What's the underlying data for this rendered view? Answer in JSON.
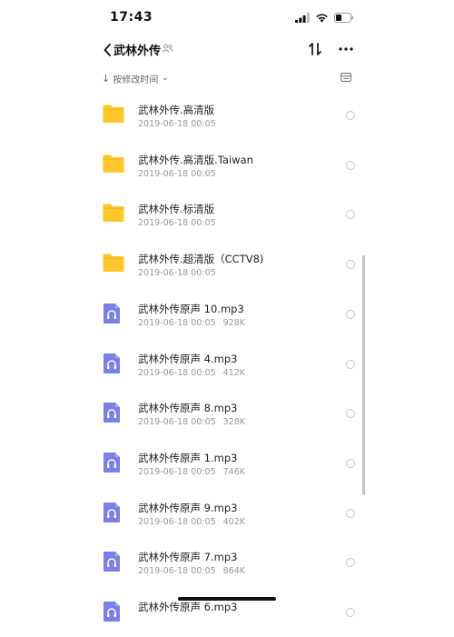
{
  "status": {
    "time": "17:43"
  },
  "header": {
    "title": "武林外传"
  },
  "sort": {
    "label": "按修改时间"
  },
  "colors": {
    "folder": "#FFC72C",
    "audio": "#7B7FE6"
  },
  "files": [
    {
      "name": "武林外传.高清版",
      "date": "2019-06-18 00:05",
      "size": "",
      "type": "folder-icon"
    },
    {
      "name": "武林外传.高清版.Taiwan",
      "date": "2019-06-18 00:05",
      "size": "",
      "type": "folder-icon"
    },
    {
      "name": "武林外传.标清版",
      "date": "2019-06-18 00:05",
      "size": "",
      "type": "folder-icon"
    },
    {
      "name": "武林外传.超清版（CCTV8)",
      "date": "2019-06-18 00:05",
      "size": "",
      "type": "folder-icon"
    },
    {
      "name": "武林外传原声 10.mp3",
      "date": "2019-06-18 00:05",
      "size": "928K",
      "type": "audio-file-icon"
    },
    {
      "name": "武林外传原声 4.mp3",
      "date": "2019-06-18 00:05",
      "size": "412K",
      "type": "audio-file-icon"
    },
    {
      "name": "武林外传原声 8.mp3",
      "date": "2019-06-18 00:05",
      "size": "328K",
      "type": "audio-file-icon"
    },
    {
      "name": "武林外传原声 1.mp3",
      "date": "2019-06-18 00:05",
      "size": "746K",
      "type": "audio-file-icon"
    },
    {
      "name": "武林外传原声 9.mp3",
      "date": "2019-06-18 00:05",
      "size": "402K",
      "type": "audio-file-icon"
    },
    {
      "name": "武林外传原声 7.mp3",
      "date": "2019-06-18 00:05",
      "size": "864K",
      "type": "audio-file-icon"
    },
    {
      "name": "武林外传原声 6.mp3",
      "date": "",
      "size": "",
      "type": "audio-file-icon"
    }
  ]
}
